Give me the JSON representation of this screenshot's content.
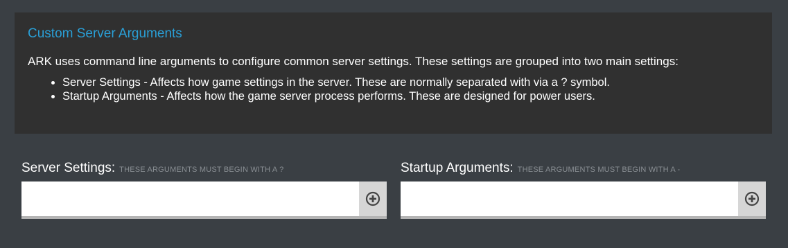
{
  "info": {
    "title": "Custom Server Arguments",
    "description": "ARK uses command line arguments to configure common server settings. These settings are grouped into two main settings:",
    "items": [
      "Server Settings - Affects how game settings in the server. These are normally separated with via a ? symbol.",
      "Startup Arguments - Affects how the game server process performs. These are designed for power users."
    ]
  },
  "server_settings": {
    "label": "Server Settings:",
    "hint": "These arguments must begin with a ?",
    "value": "",
    "add_icon": "plus-circle-icon"
  },
  "startup_arguments": {
    "label": "Startup Arguments:",
    "hint": "These arguments must begin with a -",
    "value": "",
    "add_icon": "plus-circle-icon"
  },
  "colors": {
    "page_bg": "#3a3f44",
    "panel_bg": "#303030",
    "accent": "#2a9fd6"
  }
}
